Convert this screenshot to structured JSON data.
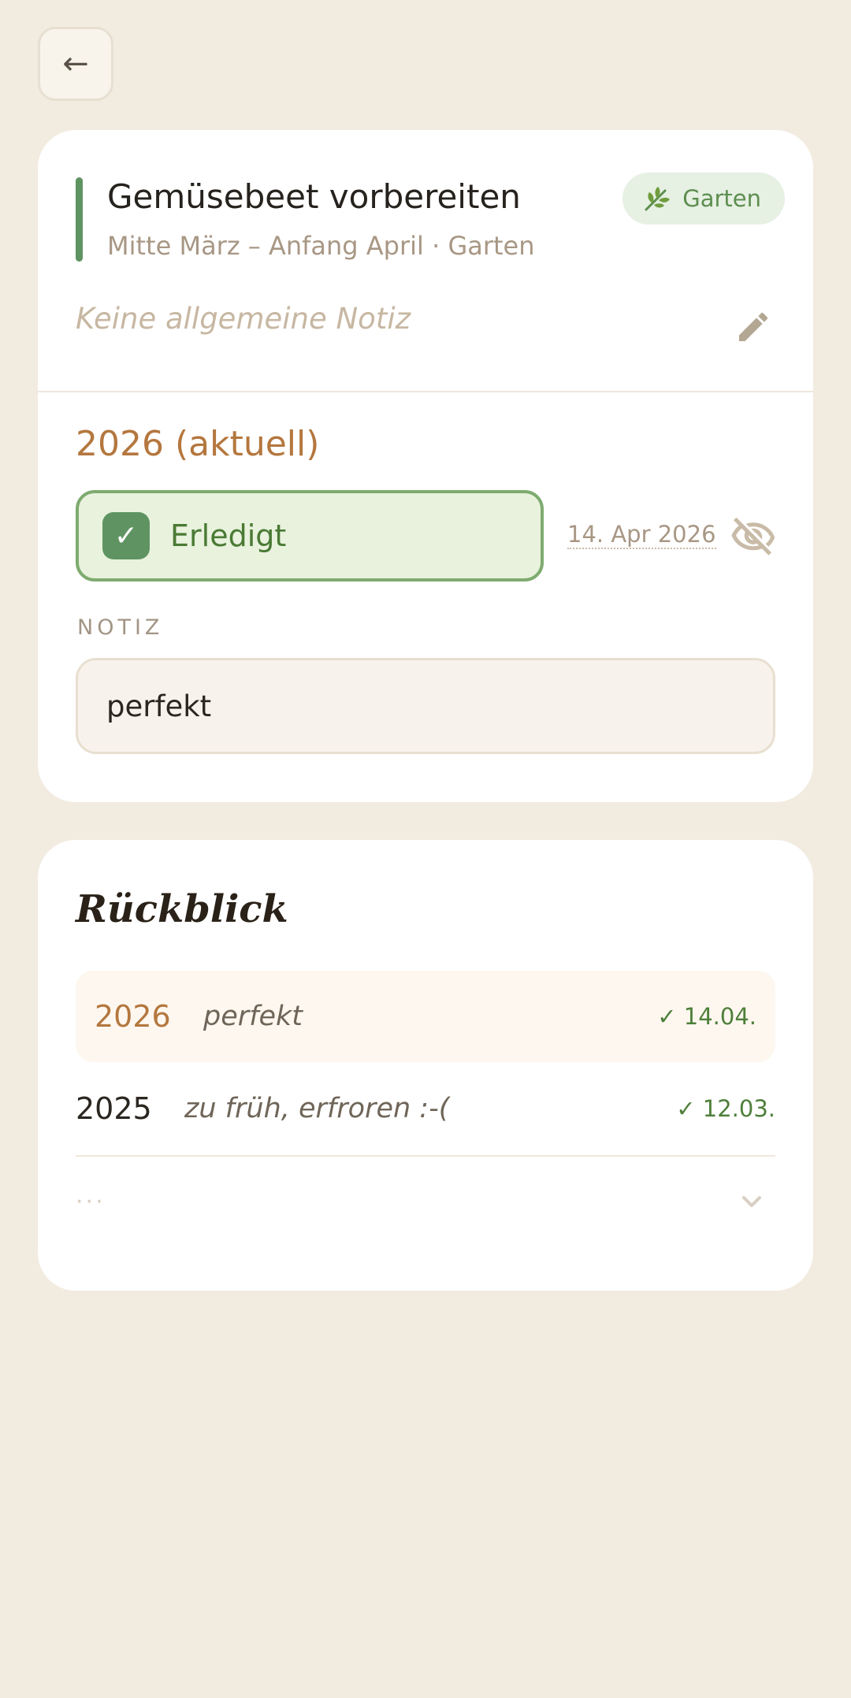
{
  "nav": {
    "back_label": "←"
  },
  "task": {
    "title": "Gemüsebeet vorbereiten",
    "subtitle": "Mitte März – Anfang April · Garten",
    "category": {
      "label": "Garten",
      "icon": "leaf-icon"
    },
    "general_note_placeholder": "Keine allgemeine Notiz",
    "accent_color": "#5f9462"
  },
  "current_year": {
    "heading": "2026 (aktuell)",
    "status_label": "Erledigt",
    "checkmark": "✓",
    "completed_date": "14. Apr 2026",
    "note_label": "NOTIZ",
    "note_value": "perfekt"
  },
  "review": {
    "title": "Rückblick",
    "entries": [
      {
        "year": "2026",
        "note": "perfekt",
        "date": "✓ 14.04."
      },
      {
        "year": "2025",
        "note": "zu früh, erfroren :-(",
        "date": "✓ 12.03."
      }
    ],
    "more_label": "···"
  }
}
